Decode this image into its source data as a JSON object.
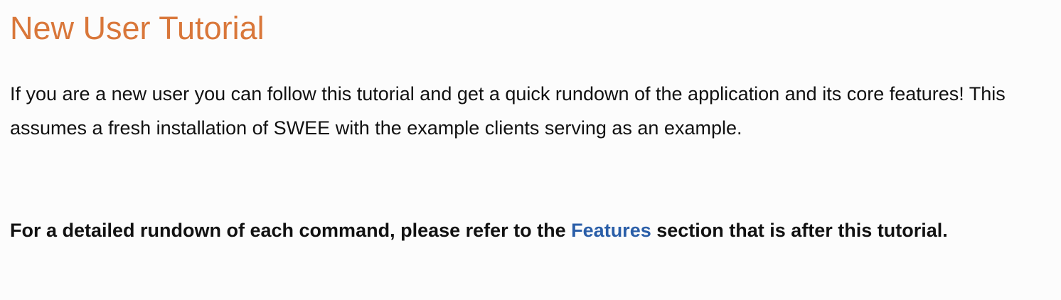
{
  "colors": {
    "title": "#d9773a",
    "link": "#2a5ea8",
    "text": "#111111",
    "background": "#fcfcfc"
  },
  "heading": {
    "title": "New User Tutorial"
  },
  "intro": {
    "text": "If you are a new user you can follow this tutorial and get a quick rundown of the application and its core features! This assumes a fresh installation of SWEE with the example clients serving as an example."
  },
  "note": {
    "before": "For a detailed rundown of each command, please refer to the ",
    "link_label": "Features",
    "after": " section that is after this tutorial."
  }
}
